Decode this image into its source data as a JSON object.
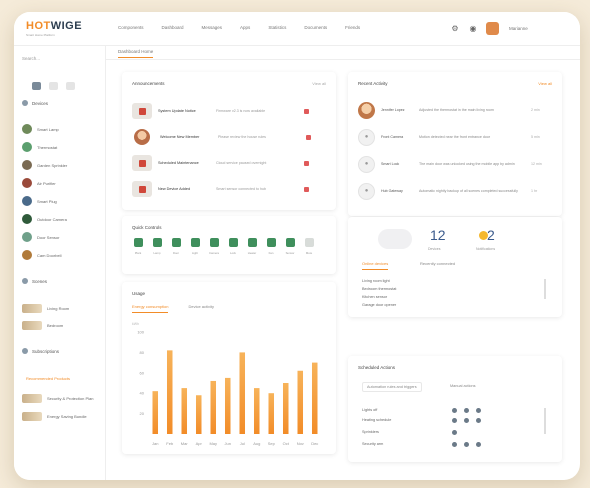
{
  "app": {
    "logo_main": "HOTWIGE",
    "logo_accent": "HOT",
    "logo_rest": "WIGE",
    "logo_sub": "Smart Home Platform"
  },
  "nav": [
    "Components",
    "Dashboard",
    "Messages",
    "Apps",
    "Statistics",
    "Documents",
    "Friends"
  ],
  "user": {
    "name": "Marianne"
  },
  "sidebar": {
    "search_placeholder": "Search...",
    "sections": [
      "Devices",
      "Scenes",
      "Subscriptions"
    ],
    "devices": [
      {
        "label": "Smart Lamp",
        "color": "#6f8a5a"
      },
      {
        "label": "Thermostat",
        "color": "#5b9f6e"
      },
      {
        "label": "Garden Sprinkler",
        "color": "#7a6a52"
      },
      {
        "label": "Air Purifier",
        "color": "#9a4a3a"
      },
      {
        "label": "Smart Plug",
        "color": "#4a6a8a"
      },
      {
        "label": "Outdoor Camera",
        "color": "#2f5a3a"
      },
      {
        "label": "Door Sensor",
        "color": "#6fa08a"
      },
      {
        "label": "Cam Doorbell",
        "color": "#b07a3a"
      }
    ],
    "scenes": [
      "Living Room",
      "Bedroom"
    ],
    "highlight": "Recommended Products",
    "subscriptions": [
      "Security & Protection Plan",
      "Energy Saving Bundle"
    ]
  },
  "breadcrumb": "Dashboard Home",
  "announcements": {
    "title": "Announcements",
    "link": "View all",
    "items": [
      {
        "title": "System Update Notice",
        "desc": "Firmware v2.3 is now available"
      },
      {
        "title": "Welcome New Member",
        "desc": "Please review the house rules"
      },
      {
        "title": "Scheduled Maintenance",
        "desc": "Cloud service paused overnight"
      },
      {
        "title": "New Device Added",
        "desc": "Smart sensor connected to hub"
      }
    ]
  },
  "activity": {
    "title": "Recent Activity",
    "link": "View all",
    "items": [
      {
        "name": "Jennifer Lopez",
        "text": "Adjusted the thermostat in the main living room",
        "time": "2 min",
        "type": "avatar"
      },
      {
        "name": "Front Camera",
        "text": "Motion detected near the front entrance door",
        "time": "5 min",
        "type": "icon"
      },
      {
        "name": "Smart Lock",
        "text": "The main door was unlocked using the mobile app by admin",
        "time": "12 min",
        "type": "icon"
      },
      {
        "name": "Hub Gateway",
        "text": "Automatic nightly backup of all scenes completed successfully",
        "time": "1 hr",
        "type": "icon"
      }
    ]
  },
  "quick": {
    "title": "Quick Controls",
    "items": [
      "Plant",
      "Lamp",
      "Door",
      "Light",
      "Camera",
      "Lock",
      "Heater",
      "Fan",
      "Sensor",
      "More"
    ]
  },
  "stats": {
    "num1": "12",
    "label1": "Devices",
    "num2": "2",
    "label2": "Notifications",
    "tabs": [
      "Online devices",
      "Recently connected"
    ],
    "lines": [
      "Living room light",
      "Bedroom thermostat",
      "Kitchen sensor",
      "Garage door opener"
    ]
  },
  "usage": {
    "title": "Usage",
    "tabs": [
      "Energy consumption",
      "Device activity"
    ],
    "note": "kWh"
  },
  "controls": {
    "title": "Scheduled Actions",
    "tabs": [
      "Automation rules and triggers",
      "Manual actions"
    ],
    "rows": [
      "Lights off",
      "Heating schedule",
      "Sprinklers",
      "Security arm"
    ]
  },
  "chart_data": {
    "type": "bar",
    "categories": [
      "Jan",
      "Feb",
      "Mar",
      "Apr",
      "May",
      "Jun",
      "Jul",
      "Aug",
      "Sep",
      "Oct",
      "Nov",
      "Dec"
    ],
    "values": [
      42,
      82,
      45,
      38,
      52,
      55,
      80,
      45,
      40,
      50,
      62,
      70
    ],
    "ylim": [
      0,
      100
    ],
    "yticks": [
      "100",
      "80",
      "60",
      "40",
      "20"
    ],
    "bar_color": "#f28c28",
    "grid": false
  }
}
